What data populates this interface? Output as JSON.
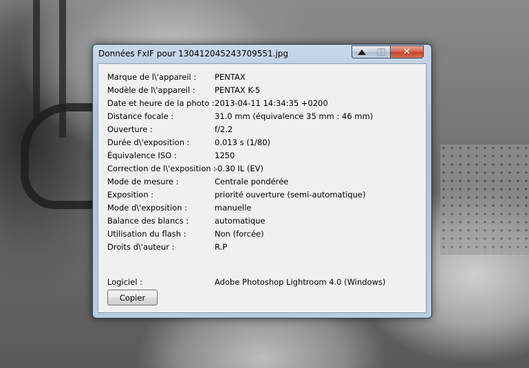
{
  "window": {
    "title": "Données FxIF pour 130412045243709551.jpg"
  },
  "exif": {
    "rows": [
      {
        "label": "Marque de l\\'appareil :",
        "value": "PENTAX"
      },
      {
        "label": "Modèle de l\\'appareil :",
        "value": "PENTAX K-5"
      },
      {
        "label": "Date et heure de la photo :",
        "value": "2013-04-11 14:34:35 +0200"
      },
      {
        "label": "Distance focale :",
        "value": "31.0 mm (équivalence 35 mm : 46 mm)"
      },
      {
        "label": "Ouverture :",
        "value": "f/2.2"
      },
      {
        "label": "Durée d\\'exposition :",
        "value": "0.013 s (1/80)"
      },
      {
        "label": "Équivalence ISO :",
        "value": "1250"
      },
      {
        "label": "Correction de l\\'exposition :",
        "value": "-0.30 IL (EV)"
      },
      {
        "label": "Mode de mesure :",
        "value": "Centrale pondérée"
      },
      {
        "label": "Exposition :",
        "value": "priorité ouverture (semi-automatique)"
      },
      {
        "label": "Mode d\\'exposition :",
        "value": "manuelle"
      },
      {
        "label": "Balance des blancs :",
        "value": "automatique"
      },
      {
        "label": "Utilisation du flash :",
        "value": "Non (forcée)"
      },
      {
        "label": "Droits d\\'auteur :",
        "value": "R.P"
      }
    ],
    "software": {
      "label": "Logiciel :",
      "value": "Adobe Photoshop Lightroom 4.0 (Windows)"
    }
  },
  "buttons": {
    "copy_label": "Copier"
  },
  "icons": {
    "minimize": "minimize-icon",
    "maximize": "maximize-icon",
    "close": "close-icon"
  },
  "colors": {
    "close_button": "#c3452a",
    "dialog_background": "#f0f0f0"
  }
}
